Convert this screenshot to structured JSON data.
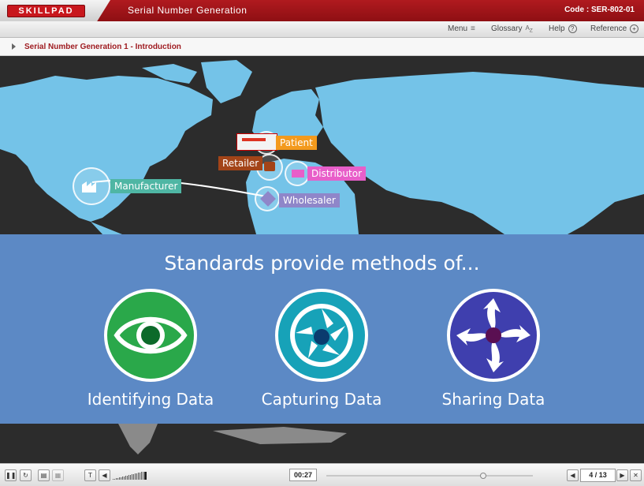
{
  "header": {
    "logo_text": "SKILLPAD",
    "title": "Serial Number Generation",
    "code_label": "Code :",
    "code_value": "SER-802-01"
  },
  "nav": {
    "menu": "Menu",
    "glossary": "Glossary",
    "help": "Help",
    "reference": "Reference"
  },
  "breadcrumb": "Serial Number Generation 1 - Introduction",
  "map": {
    "manufacturer": "Manufacturer",
    "retailer": "Retailer",
    "patient": "Patient",
    "distributor": "Distributor",
    "wholesaler": "Wholesaler",
    "colors": {
      "manufacturer": "#4fb6a4",
      "retailer": "#a34418",
      "patient": "#f39a1d",
      "distributor": "#e85ec9",
      "wholesaler": "#8f86c9"
    }
  },
  "main": {
    "heading": "Standards provide methods of...",
    "methods": [
      {
        "label": "Identifying Data",
        "icon": "eye-icon",
        "color": "#2aa84a"
      },
      {
        "label": "Capturing Data",
        "icon": "camera-aperture-icon",
        "color": "#17a2b8"
      },
      {
        "label": "Sharing Data",
        "icon": "share-arrows-icon",
        "color": "#3f3fae"
      }
    ]
  },
  "player": {
    "time": "00:27",
    "page": "4 / 13",
    "progress": 0.76
  }
}
